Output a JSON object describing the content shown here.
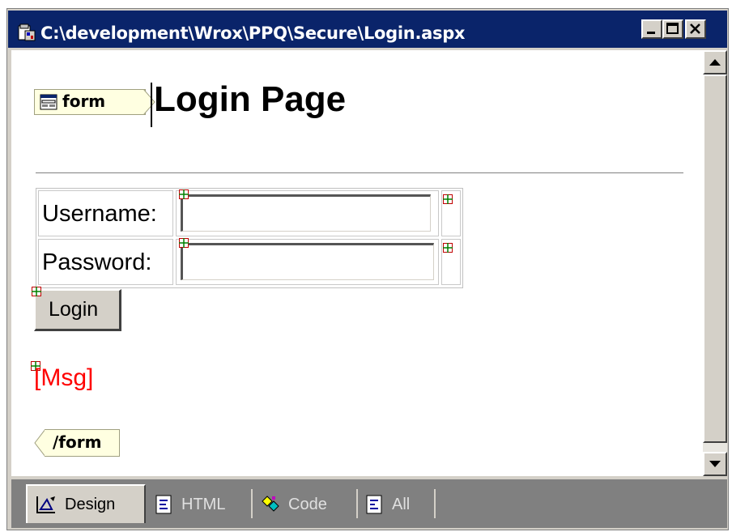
{
  "window": {
    "title": "C:\\development\\Wrox\\PPQ\\Secure\\Login.aspx"
  },
  "page": {
    "form_open_tag": "form",
    "heading": "Login Page",
    "username_label": "Username:",
    "password_label": "Password:",
    "username_value": "",
    "password_value": "",
    "login_button": "Login",
    "msg_label": "[Msg]",
    "form_close_tag": "/form"
  },
  "tabs": [
    {
      "label": "Design",
      "icon": "design-icon"
    },
    {
      "label": "HTML",
      "icon": "html-icon"
    },
    {
      "label": "Code",
      "icon": "code-icon"
    },
    {
      "label": "All",
      "icon": "all-icon"
    }
  ],
  "colors": {
    "titlebar": "#0a246a",
    "msg": "#ff0000",
    "chrome": "#d4d0c8"
  }
}
